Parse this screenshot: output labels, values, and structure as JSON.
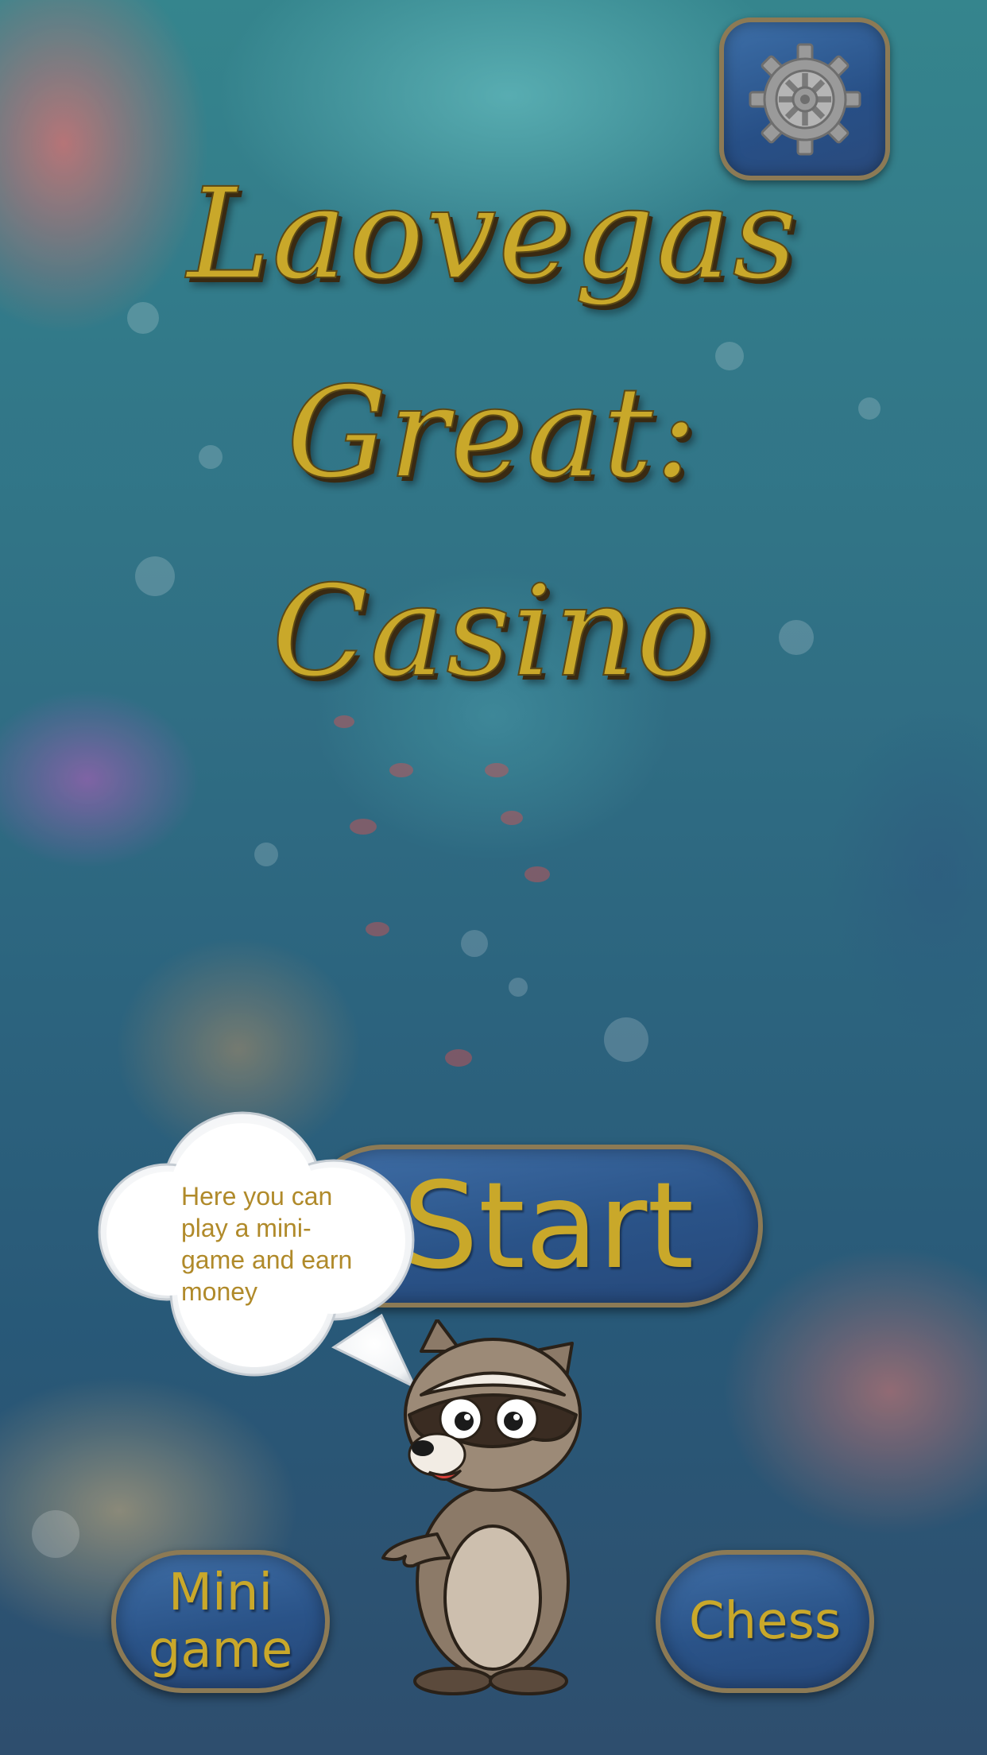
{
  "title": {
    "line1": "Laovegas",
    "line2": "Great:",
    "line3": "Casino"
  },
  "settings": {
    "icon": "gear-icon"
  },
  "buttons": {
    "start": "Start",
    "mini_game_line1": "Mini",
    "mini_game_line2": "game",
    "chess": "Chess"
  },
  "speech_bubble": {
    "text": "Here you can play a mini-game and earn money"
  },
  "mascot": {
    "icon": "raccoon-character"
  },
  "colors": {
    "gold_text": "#c9a82a",
    "button_blue": "#2a5388",
    "button_border": "#8c7a55",
    "speech_text": "#b08a2a"
  }
}
